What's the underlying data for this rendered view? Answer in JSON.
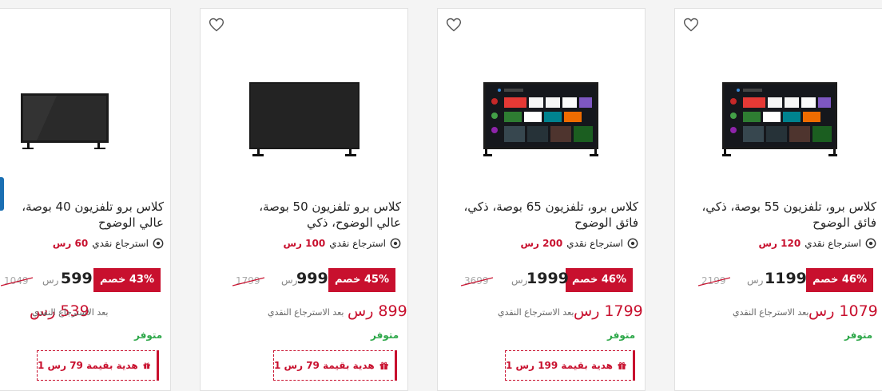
{
  "colors": {
    "accent": "#c8102e",
    "stock": "#2ea84a",
    "tab": "#1a6fb3"
  },
  "products": [
    {
      "title": "كلاس برو، تلفزيون 55 بوصة، ذكي، فائق الوضوح",
      "cashback_label": "استرجاع نقدي",
      "cashback_amount": "120 رس",
      "discount": "46% خصم",
      "price": "1199",
      "currency": "رس",
      "old_price": "2199",
      "after_price": "1079 رس",
      "after_label": "بعد الاسترجاع النقدي",
      "stock": "متوفر",
      "gift": null,
      "favorite_icon": "heart-outline-icon",
      "screen": "smart"
    },
    {
      "title": "كلاس برو، تلفزيون 65 بوصة، ذكي، فائق الوضوح",
      "cashback_label": "استرجاع نقدي",
      "cashback_amount": "200 رس",
      "discount": "46% خصم",
      "price": "1999",
      "currency": "رس",
      "old_price": "3699",
      "after_price": "1799 رس",
      "after_label": "بعد الاسترجاع النقدي",
      "stock": "متوفر",
      "gift": "1 هدية بقيمة 199 رس",
      "favorite_icon": "heart-outline-icon",
      "screen": "smart"
    },
    {
      "title": "كلاس برو تلفزيون 50 بوصة، عالي الوضوح، ذكي",
      "cashback_label": "استرجاع نقدي",
      "cashback_amount": "100 رس",
      "discount": "45% خصم",
      "price": "999",
      "currency": "رس",
      "old_price": "1799",
      "after_price": "899 رس",
      "after_label": "بعد الاسترجاع النقدي",
      "stock": "متوفر",
      "gift": "1 هدية بقيمة 79 رس",
      "favorite_icon": "heart-outline-icon",
      "screen": "black"
    },
    {
      "title": "كلاس برو تلفزيون 40 بوصة، عالي الوضوح",
      "cashback_label": "استرجاع نقدي",
      "cashback_amount": "60 رس",
      "discount": "43% خصم",
      "price": "599",
      "currency": "رس",
      "old_price": "1049",
      "after_price": "539 رس",
      "after_label": "بعد الاسترجاع النقدي",
      "stock": "متوفر",
      "gift": "1 هدية بقيمة 79 رس",
      "favorite_icon": "heart-outline-icon",
      "screen": "black"
    }
  ]
}
